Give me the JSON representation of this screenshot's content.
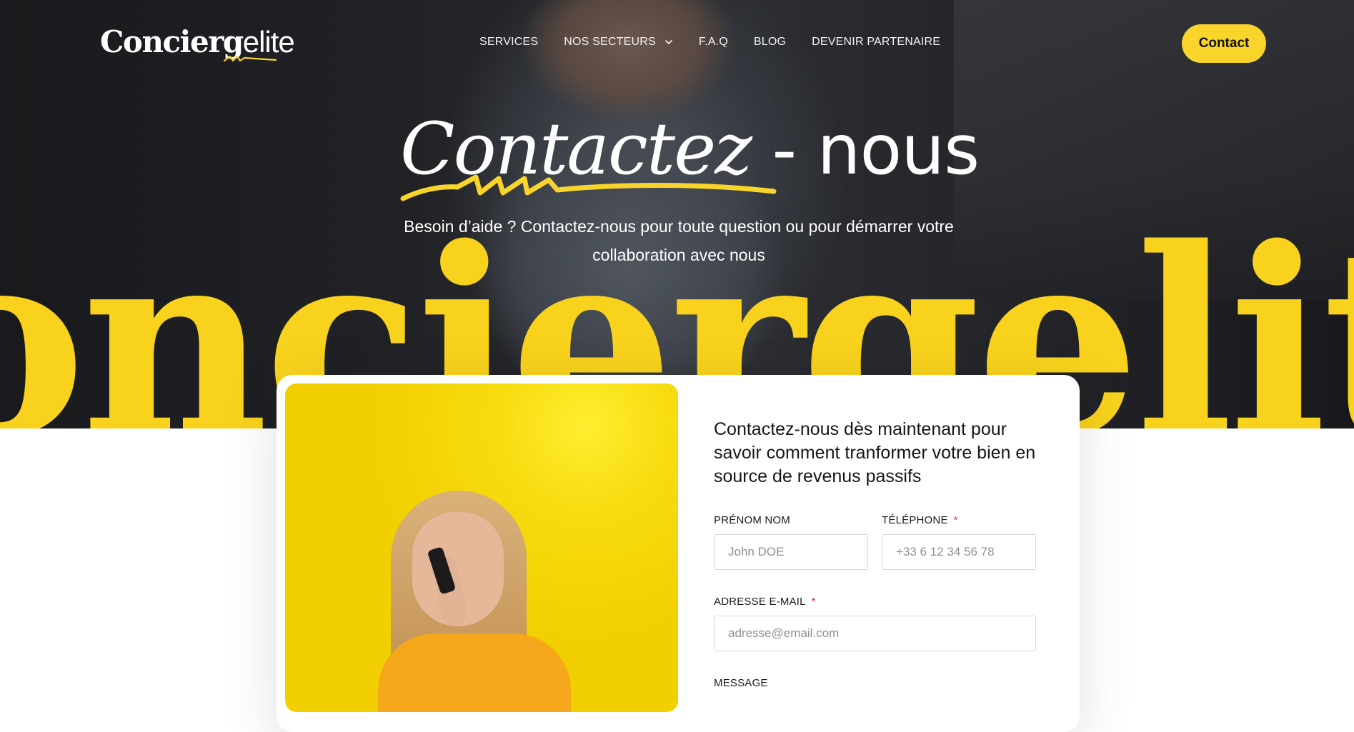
{
  "brand": {
    "name_bold": "Concierg",
    "name_light": "elite",
    "accent": "#f9d42a"
  },
  "nav": {
    "items": [
      {
        "label": "SERVICES"
      },
      {
        "label": "NOS SECTEURS",
        "has_dropdown": true
      },
      {
        "label": "F.A.Q"
      },
      {
        "label": "BLOG"
      },
      {
        "label": "DEVENIR PARTENAIRE"
      }
    ],
    "cta_label": "Contact"
  },
  "hero": {
    "title_script": "Contactez",
    "title_plain": " - nous",
    "subtitle_line1": "Besoin d’aide ? Contactez-nous pour toute question ou pour démarrer votre",
    "subtitle_line2": "collaboration avec nous",
    "background_word": "onciergelit"
  },
  "form": {
    "heading": "Contactez-nous dès maintenant pour savoir comment tranformer votre bien en source de revenus passifs",
    "name_label": "PRÉNOM NOM",
    "name_placeholder": "John DOE",
    "phone_label": "TÉLÉPHONE",
    "phone_placeholder": "+33 6 12 34 56 78",
    "email_label": "ADRESSE E-MAIL",
    "email_placeholder": "adresse@email.com",
    "message_label": "MESSAGE",
    "required_mark": "*"
  }
}
